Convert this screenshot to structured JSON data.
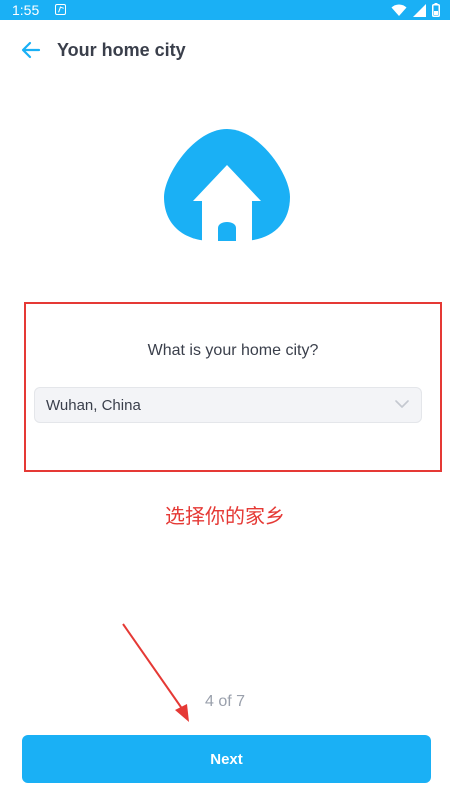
{
  "status_bar": {
    "time": "1:55",
    "icons": [
      "app-notification-icon",
      "wifi-icon",
      "signal-icon",
      "battery-icon"
    ]
  },
  "header": {
    "title": "Your home city",
    "back_icon": "arrow-left-icon"
  },
  "illustration": {
    "icon": "home-pin-icon",
    "color": "#1ab0f5"
  },
  "question": {
    "prompt": "What is your home city?",
    "selected_city": "Wuhan, China"
  },
  "annotation": {
    "text": "选择你的家乡",
    "color": "#e53935"
  },
  "footer": {
    "step": "4 of 7",
    "next_label": "Next"
  },
  "colors": {
    "accent": "#1ab0f5",
    "title_text": "#3a3f4b",
    "muted_text": "#9aa0ac",
    "annotation": "#e53935"
  }
}
